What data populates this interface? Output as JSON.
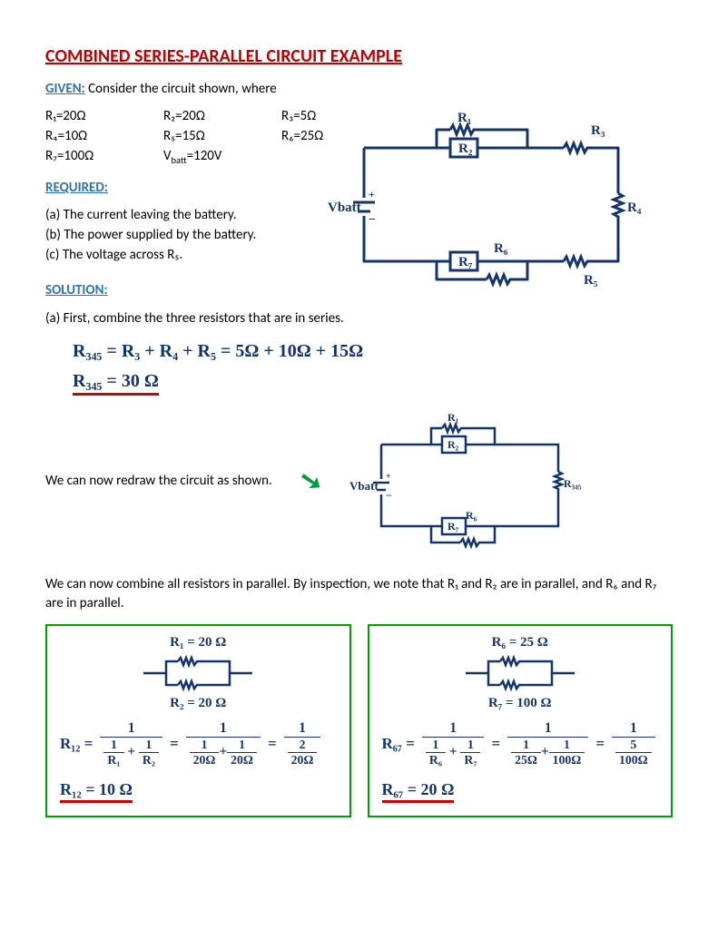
{
  "title": "COMBINED SERIES-PARALLEL CIRCUIT EXAMPLE",
  "given_label": "GIVEN:",
  "given_intro": " Consider the circuit shown, where",
  "given": {
    "r1": "R₁=20Ω",
    "r2": "R₂=20Ω",
    "r3": "R₃=5Ω",
    "r4": "R₄=10Ω",
    "r5": "R₅=15Ω",
    "r6": "R₆=25Ω",
    "r7": "R₇=100Ω",
    "vb": "Vbatt=120V"
  },
  "required_label": "REQUIRED:",
  "required": {
    "a": "(a) The current leaving the battery.",
    "b": "(b) The power supplied by the battery.",
    "c": "(c) The voltage across R₅."
  },
  "solution_label": "SOLUTION:",
  "sol_a_intro": "(a) First, combine the three resistors that are in series.",
  "eq1": "R₃₄₅  =  R₃ + R₄ + R₅  =  5Ω + 10Ω + 15Ω",
  "eq1b": "R₃₄₅ =  30 Ω",
  "redraw_text": "We can now redraw the circuit as shown.",
  "para_text": "We can now combine all resistors in parallel. By inspection, we note that R₁ and R₂ are in parallel, and R₆ and R₇ are in parallel.",
  "box1": {
    "top": "R₁ = 20 Ω",
    "bot": "R₂ = 20 Ω",
    "lhs": "R₁₂ =",
    "r1": "R₁",
    "r2": "R₂",
    "v1": "20Ω",
    "v2": "20Ω",
    "vr": "20Ω",
    "result": "R₁₂ =  10 Ω"
  },
  "box2": {
    "top": "R₆ = 25 Ω",
    "bot": "R₇ = 100 Ω",
    "lhs": "R₆₇ =",
    "r1": "R₆",
    "r2": "R₇",
    "v1": "25Ω",
    "v2": "100Ω",
    "vr": "100Ω",
    "result": "R₆₇ =  20 Ω"
  },
  "diag": {
    "vbatt": "Vbatt",
    "r1": "R₁",
    "r2": "R₂",
    "r3": "R₃",
    "r4": "R₄",
    "r5": "R₅",
    "r6": "R₆",
    "r7": "R₇",
    "r345": "R₃₄₅"
  }
}
